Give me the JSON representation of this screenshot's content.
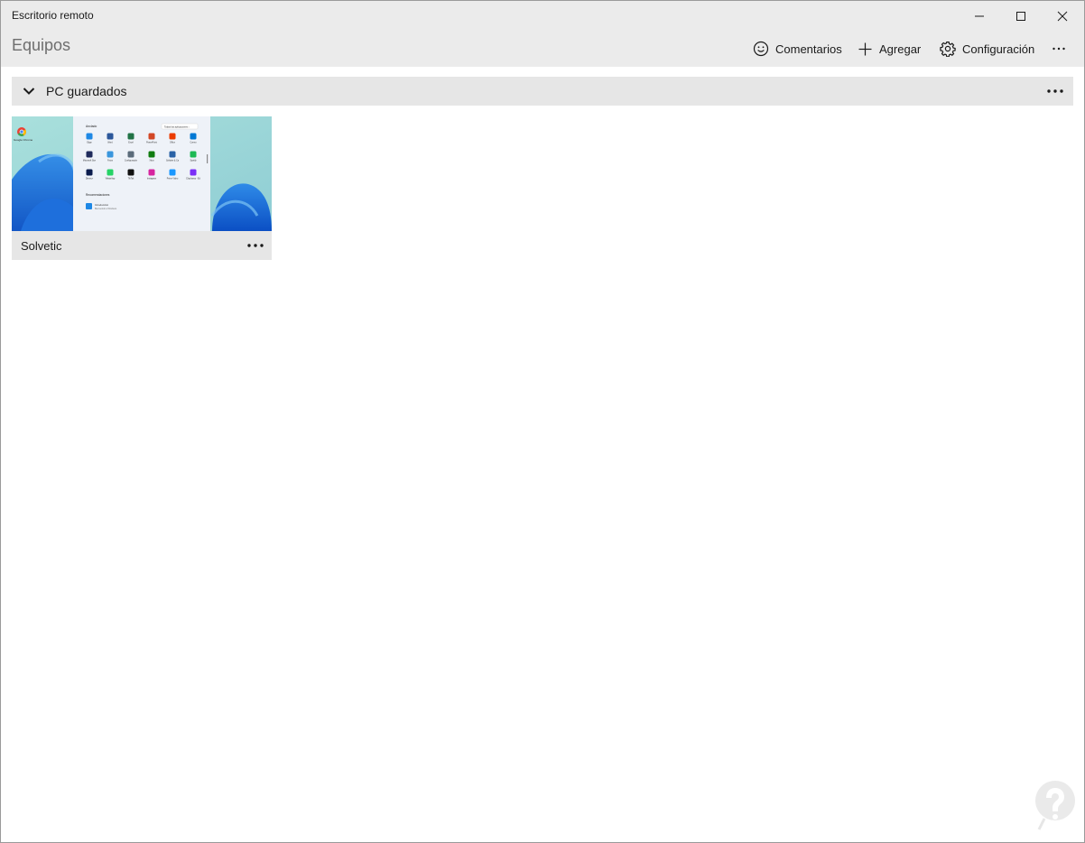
{
  "window": {
    "title": "Escritorio remoto",
    "controls": [
      "minimize-icon",
      "maximize-icon",
      "close-icon"
    ]
  },
  "header": {
    "title": "Equipos",
    "commands": {
      "feedback": {
        "label": "Comentarios",
        "icon": "smiley-icon"
      },
      "add": {
        "label": "Agregar",
        "icon": "plus-icon"
      },
      "settings": {
        "label": "Configuración",
        "icon": "gear-icon"
      },
      "more": {
        "icon": "more-icon"
      }
    }
  },
  "group": {
    "label": "PC guardados",
    "expanded": true,
    "more_icon": "more-icon"
  },
  "pcs": [
    {
      "name": "Solvetic",
      "thumbnail": {
        "desktop_icon_label": "Google Chrome",
        "menu": {
          "pinned_title": "Anclado",
          "all_apps_label": "Todas las aplicaciones  ›",
          "apps": [
            "Edge",
            "Word",
            "Excel",
            "PowerPoint",
            "Office",
            "Correo",
            "Microsoft Store",
            "Fotos",
            "Configuración",
            "Xbox",
            "Solitaire & Casual Games",
            "Spotify",
            "Disney+",
            "WhatsApp",
            "TikTok",
            "Instagram",
            "Prime Video",
            "Clipchamp - Editor de vídeo"
          ],
          "recommended_title": "Recomendaciones",
          "recommended_item": "Introducción",
          "recommended_sub": "Bienvenido a Windows"
        }
      }
    }
  ],
  "colors": {
    "chrome_bg": "#ebebeb",
    "group_bg": "#e6e6e6",
    "accent": "#0067c0"
  }
}
